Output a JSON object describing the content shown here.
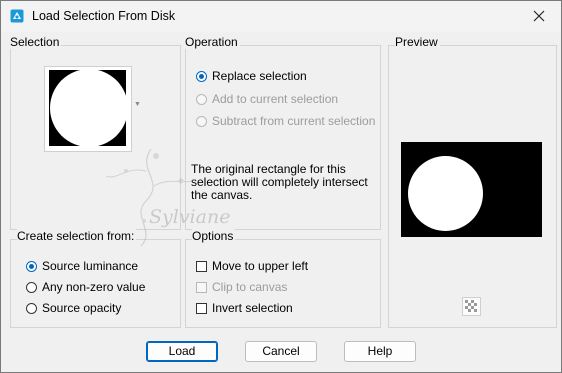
{
  "window": {
    "title": "Load Selection From Disk"
  },
  "selection_group": {
    "title": "Selection"
  },
  "operation_group": {
    "title": "Operation",
    "options": [
      {
        "label": "Replace selection",
        "checked": true,
        "disabled": false
      },
      {
        "label": "Add to current selection",
        "checked": false,
        "disabled": true
      },
      {
        "label": "Subtract from current selection",
        "checked": false,
        "disabled": true
      }
    ],
    "info": "The original rectangle for this selection will completely intersect the canvas."
  },
  "preview_group": {
    "title": "Preview"
  },
  "create_group": {
    "title": "Create selection from:",
    "options": [
      {
        "label": "Source luminance",
        "checked": true
      },
      {
        "label": "Any non-zero value",
        "checked": false
      },
      {
        "label": "Source opacity",
        "checked": false
      }
    ]
  },
  "options_group": {
    "title": "Options",
    "items": [
      {
        "label": "Move to upper left",
        "checked": false,
        "disabled": false
      },
      {
        "label": "Clip to canvas",
        "checked": false,
        "disabled": true
      },
      {
        "label": "Invert selection",
        "checked": false,
        "disabled": false
      }
    ]
  },
  "watermark": {
    "text": "Sylviane"
  },
  "buttons": {
    "load": "Load",
    "cancel": "Cancel",
    "help": "Help"
  },
  "colors": {
    "accent": "#0067c0",
    "border": "#d4d4d4",
    "background": "#f0f0f0"
  },
  "icons": {
    "app": "paint-shop-icon",
    "close": "close-icon",
    "checkerboard": "checkerboard-icon"
  }
}
